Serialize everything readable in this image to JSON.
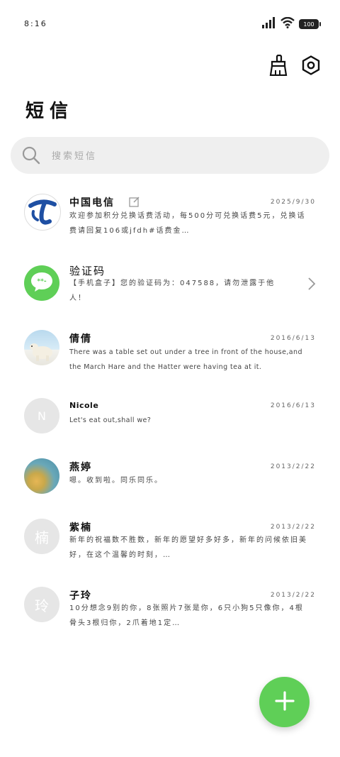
{
  "status": {
    "time": "8:16",
    "battery": "100"
  },
  "header": {
    "title": "短信"
  },
  "search": {
    "placeholder": "搜索短信"
  },
  "conversations": [
    {
      "name": "中国电信",
      "date": "2025/9/30",
      "preview": "欢迎参加积分兑换话费活动，每500分可兑换话费5元，兑换话费请回复106或jfdh#话费金…"
    },
    {
      "name": "验证码",
      "date": "",
      "preview": "【手机盒子】您的验证码为：047588，请勿泄露于他人！"
    },
    {
      "name": "倩倩",
      "date": "2016/6/13",
      "preview": "There was a table set out under a tree in front of the house,and the March Hare and the Hatter were having tea at it."
    },
    {
      "name": "Nicole",
      "date": "2016/6/13",
      "preview": "Let's eat out,shall we?",
      "initial": "N"
    },
    {
      "name": "燕婷",
      "date": "2013/2/22",
      "preview": "嗯。收到啦。同乐同乐。"
    },
    {
      "name": "紫楠",
      "date": "2013/2/22",
      "preview": "新年的祝福数不胜数，新年的愿望好多好多，新年的问候依旧美好，在这个温馨的时刻，…",
      "initial": "楠"
    },
    {
      "name": "子玲",
      "date": "2013/2/22",
      "preview": "10分想念9别的你，8张照片7张是你，6只小狗5只像你，4根骨头3根归你，2爪着地1定…",
      "initial": "玲"
    }
  ],
  "colors": {
    "accent": "#5fcf57",
    "telecom_blue": "#1e4fa3",
    "search_bg": "#efefef"
  },
  "icons": [
    "signal-icon",
    "wifi-icon",
    "battery-icon",
    "brush-icon",
    "settings-icon",
    "search-icon",
    "edit-icon",
    "chat-bubble-icon",
    "chevron-right-icon",
    "plus-icon"
  ]
}
